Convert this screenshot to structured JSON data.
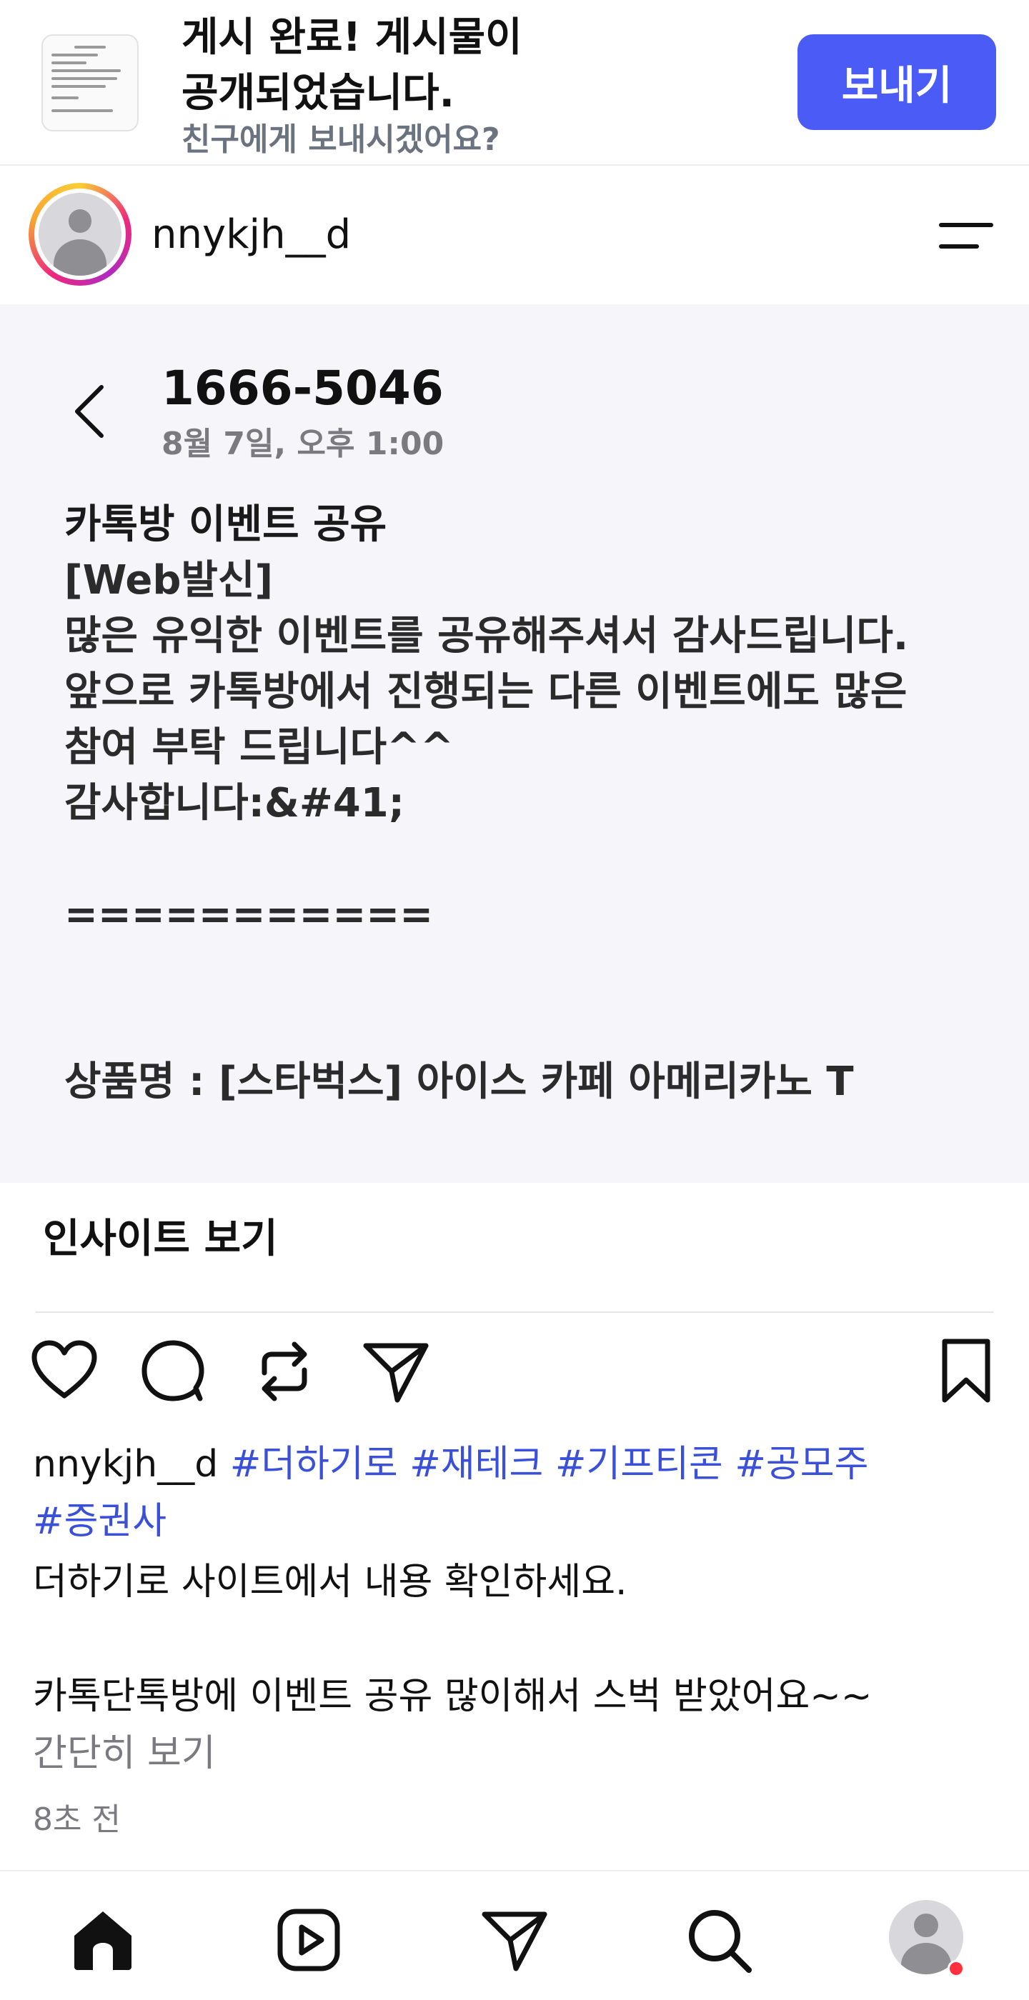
{
  "banner": {
    "title_line1": "게시 완료! 게시물이",
    "title_line2": "공개되었습니다.",
    "subtitle": "친구에게 보내시겠어요?",
    "send_label": "보내기"
  },
  "post": {
    "username": "nnykjh__d"
  },
  "message": {
    "sender": "1666-5046",
    "date": "8월 7일, 오후 1:00",
    "lines": [
      "카톡방 이벤트 공유",
      "[Web발신]",
      "많은 유익한 이벤트를 공유해주셔서 감사드립니다.",
      "앞으로 카톡방에서 진행되는 다른 이벤트에도 많은",
      "참여 부탁 드립니다^^",
      "감사합니다:&#41;",
      "",
      "===========",
      "",
      "",
      "상품명 : [스타벅스] 아이스 카페 아메리카노 T"
    ]
  },
  "insights_label": "인사이트 보기",
  "icons": {
    "like": "heart-icon",
    "comment": "comment-icon",
    "repost": "repost-icon",
    "share": "send-icon",
    "save": "bookmark-icon",
    "back": "chevron-left-icon",
    "menu": "menu-icon"
  },
  "caption": {
    "username": "nnykjh__d",
    "tags": [
      "#더하기로",
      "#재테크",
      "#기프티콘",
      "#공모주",
      "#증권사"
    ],
    "line1": "더하기로 사이트에서 내용 확인하세요.",
    "line2": "카톡단톡방에 이벤트 공유 많이해서 스벅 받았어요~~",
    "less_label": "간단히 보기",
    "time": "8초 전"
  },
  "nav": {
    "items": [
      "home-icon",
      "reels-icon",
      "send-icon",
      "search-icon",
      "profile-avatar"
    ]
  },
  "colors": {
    "accent": "#4a5cf5",
    "hashtag": "#3b50d8",
    "notification": "#ff3040"
  }
}
